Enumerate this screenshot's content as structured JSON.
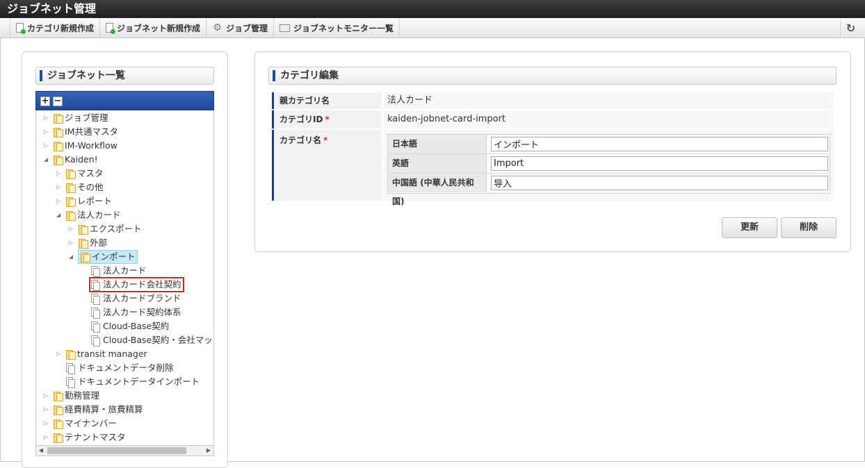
{
  "app": {
    "title": "ジョブネット管理"
  },
  "toolbar": {
    "items": [
      {
        "label": "カテゴリ新規作成",
        "icon": "new-document-icon"
      },
      {
        "label": "ジョブネット新規作成",
        "icon": "new-document-icon"
      },
      {
        "label": "ジョブ管理",
        "icon": "gear-icon"
      },
      {
        "label": "ジョブネットモニター一覧",
        "icon": "monitor-icon"
      }
    ],
    "reload_icon": "reload-icon"
  },
  "left": {
    "title": "ジョブネット一覧",
    "tree": {
      "expand_all": "+",
      "collapse_all": "−",
      "nodes": [
        {
          "label": "ジョブ管理",
          "type": "folder",
          "arrow": "▷"
        },
        {
          "label": "IM共通マスタ",
          "type": "folder",
          "arrow": "▷"
        },
        {
          "label": "IM-Workflow",
          "type": "folder",
          "arrow": "▷"
        },
        {
          "label": "Kaiden!",
          "type": "folder",
          "arrow": "◢"
        },
        {
          "label": "マスタ",
          "type": "folder",
          "arrow": "▷"
        },
        {
          "label": "その他",
          "type": "folder",
          "arrow": "▷"
        },
        {
          "label": "レポート",
          "type": "folder",
          "arrow": "▷"
        },
        {
          "label": "法人カード",
          "type": "folder",
          "arrow": "◢"
        },
        {
          "label": "エクスポート",
          "type": "folder",
          "arrow": "▷"
        },
        {
          "label": "外部",
          "type": "folder",
          "arrow": "▷"
        },
        {
          "label": "インポート",
          "type": "folder",
          "arrow": "◢",
          "selected": true
        },
        {
          "label": "法人カード",
          "type": "doc"
        },
        {
          "label": "法人カード会社契約",
          "type": "doc",
          "highlight": true
        },
        {
          "label": "法人カードブランド",
          "type": "doc"
        },
        {
          "label": "法人カード契約体系",
          "type": "doc"
        },
        {
          "label": "Cloud-Base契約",
          "type": "doc"
        },
        {
          "label": "Cloud-Base契約・会社マッピ",
          "type": "doc"
        },
        {
          "label": "transit manager",
          "type": "folder",
          "arrow": "▷"
        },
        {
          "label": "ドキュメントデータ削除",
          "type": "doc"
        },
        {
          "label": "ドキュメントデータインポート",
          "type": "doc"
        },
        {
          "label": "勤務管理",
          "type": "folder",
          "arrow": "▷"
        },
        {
          "label": "経費精算・旅費精算",
          "type": "folder",
          "arrow": "▷"
        },
        {
          "label": "マイナンバー",
          "type": "folder",
          "arrow": "▷"
        },
        {
          "label": "テナントマスタ",
          "type": "folder",
          "arrow": "▷"
        }
      ]
    },
    "scroll_left": "◀",
    "scroll_right": "▶"
  },
  "right": {
    "title": "カテゴリ編集",
    "parent_label": "親カテゴリ名",
    "parent_value": "法人カード",
    "id_label": "カテゴリID",
    "id_value": "kaiden-jobnet-card-import",
    "name_label": "カテゴリ名",
    "required_mark": "*",
    "names": [
      {
        "lang": "日本語",
        "value": "インポート"
      },
      {
        "lang": "英語",
        "value": "Import"
      },
      {
        "lang": "中国語 (中華人民共和国)",
        "value": "导入"
      }
    ],
    "update_label": "更新",
    "delete_label": "削除"
  },
  "colors": {
    "accent": "#1f4e99",
    "titlebar": "#2b2b2b",
    "highlight": "#e01e1e",
    "selected": "#c7e9fb"
  }
}
